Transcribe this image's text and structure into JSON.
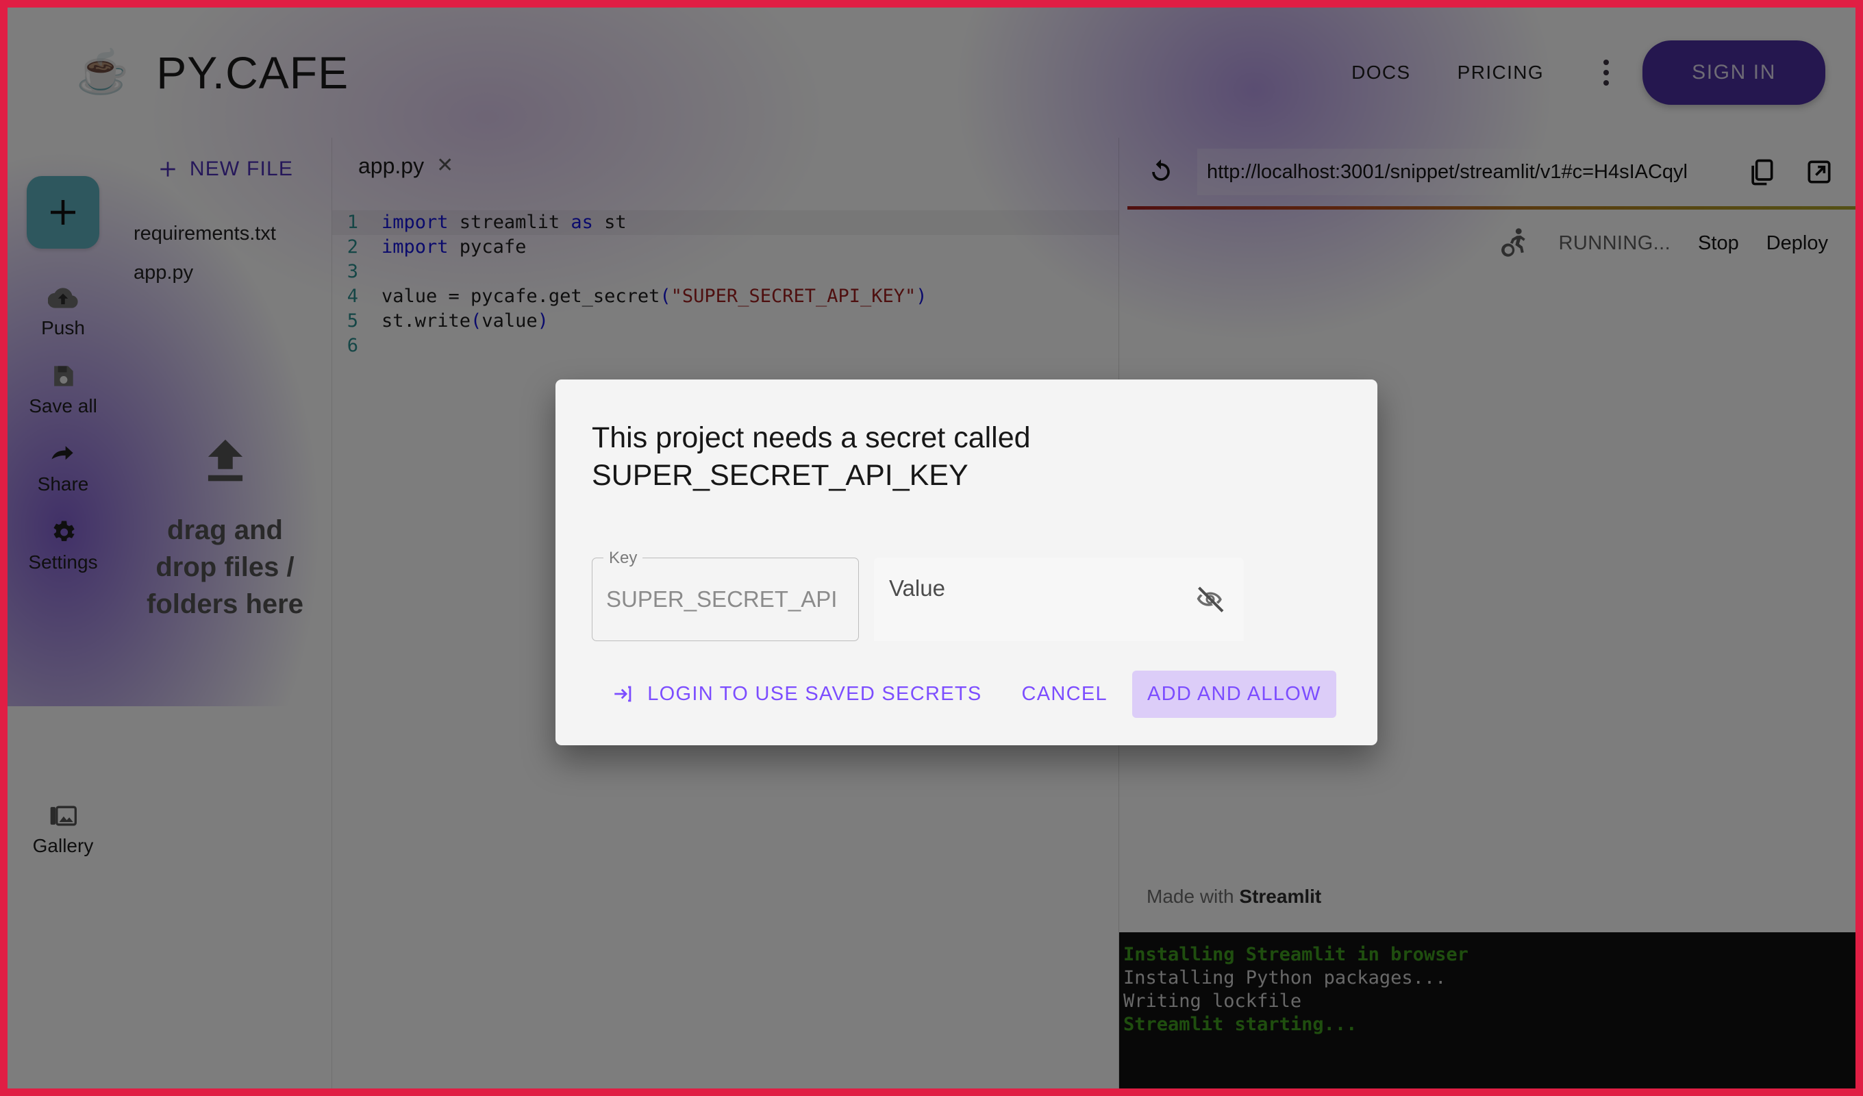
{
  "theme": {
    "page_border": "#e01e44",
    "accent_purple": "#7c4dff",
    "signin_purple": "#4b2f9e",
    "add_button_teal": "#5cafbd",
    "highlight_lavender": "#dccdf8",
    "terminal_green": "#3f9c1e",
    "scrim": "rgba(0,0,0,0.50)"
  },
  "header": {
    "logo_icon": "coffee-cup-icon",
    "logo_emoji": "☕",
    "brand": "PY.CAFE",
    "nav": [
      {
        "label": "DOCS"
      },
      {
        "label": "PRICING"
      }
    ],
    "more_icon": "kebab-menu-icon",
    "signin_label": "SIGN IN"
  },
  "rail": {
    "add_icon": "plus-icon",
    "items": [
      {
        "label": "Push",
        "icon": "cloud-upload-icon"
      },
      {
        "label": "Save all",
        "icon": "floppy-disk-icon"
      },
      {
        "label": "Share",
        "icon": "share-arrow-icon"
      },
      {
        "label": "Settings",
        "icon": "gear-icon"
      }
    ],
    "gallery": {
      "label": "Gallery",
      "icon": "image-icon"
    }
  },
  "explorer": {
    "new_file_label": "NEW FILE",
    "new_file_icon": "plus-icon",
    "files": [
      {
        "name": "requirements.txt"
      },
      {
        "name": "app.py"
      }
    ],
    "dropzone_icon": "upload-icon",
    "dropzone_text": "drag and drop files / folders here"
  },
  "editor": {
    "tab": {
      "label": "app.py",
      "close_icon": "close-icon"
    },
    "lines": [
      {
        "no": "1",
        "segments": [
          {
            "t": "import",
            "c": "kw"
          },
          {
            "t": " streamlit ",
            "c": ""
          },
          {
            "t": "as",
            "c": "kw"
          },
          {
            "t": " st",
            "c": ""
          }
        ]
      },
      {
        "no": "2",
        "segments": [
          {
            "t": "import",
            "c": "kw"
          },
          {
            "t": " pycafe",
            "c": ""
          }
        ]
      },
      {
        "no": "3",
        "segments": [
          {
            "t": "",
            "c": ""
          }
        ]
      },
      {
        "no": "4",
        "segments": [
          {
            "t": "value = pycafe.get_secret",
            "c": ""
          },
          {
            "t": "(",
            "c": "paren"
          },
          {
            "t": "\"SUPER_SECRET_API_KEY\"",
            "c": "str"
          },
          {
            "t": ")",
            "c": "paren"
          }
        ]
      },
      {
        "no": "5",
        "segments": [
          {
            "t": "st.write",
            "c": ""
          },
          {
            "t": "(",
            "c": "paren"
          },
          {
            "t": "value",
            "c": ""
          },
          {
            "t": ")",
            "c": "paren"
          }
        ]
      },
      {
        "no": "6",
        "segments": [
          {
            "t": "",
            "c": ""
          }
        ]
      }
    ]
  },
  "preview": {
    "refresh_icon": "refresh-icon",
    "url": "http://localhost:3001/snippet/streamlit/v1#c=H4sIACqyl",
    "copy_icon": "copy-icon",
    "open_external_icon": "open-in-new-icon",
    "run_icon": "running-person-icon",
    "run_status": "RUNNING...",
    "stop_label": "Stop",
    "deploy_label": "Deploy",
    "made_with_prefix": "Made with ",
    "made_with_brand": "Streamlit",
    "terminal": [
      {
        "text": "Installing Streamlit in browser",
        "style": "green"
      },
      {
        "text": "Installing Python packages...",
        "style": "grey"
      },
      {
        "text": "Writing lockfile",
        "style": "grey"
      },
      {
        "text": "Streamlit starting...",
        "style": "green"
      }
    ]
  },
  "dialog": {
    "title": "This project needs a secret called SUPER_SECRET_API_KEY",
    "key_field": {
      "legend": "Key",
      "value": "SUPER_SECRET_API"
    },
    "value_field": {
      "label": "Value",
      "value": "",
      "toggle_icon": "eye-off-icon"
    },
    "actions": {
      "login_icon": "login-arrow-icon",
      "login_label": "LOGIN TO USE SAVED SECRETS",
      "cancel_label": "CANCEL",
      "confirm_label": "ADD AND ALLOW"
    }
  }
}
